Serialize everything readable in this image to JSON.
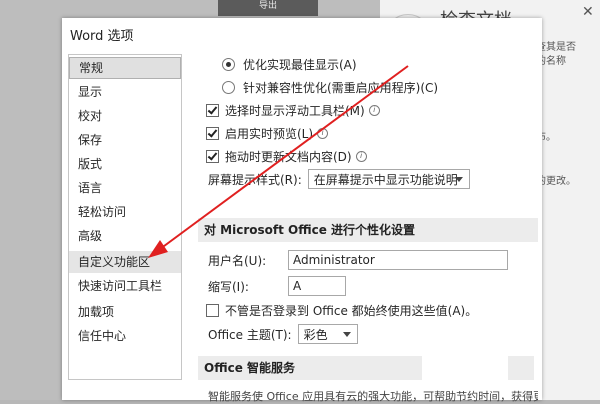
{
  "background": {
    "button_label": "导出",
    "heading": "检查文档",
    "side_texts": [
      "查其是否",
      "的名称",
      "布。",
      "的更改。"
    ],
    "close_glyph": "✕"
  },
  "dialog": {
    "title": "Word 选项",
    "nav_items": [
      {
        "label": "常规",
        "state": "active"
      },
      {
        "label": "显示",
        "state": "normal"
      },
      {
        "label": "校对",
        "state": "normal"
      },
      {
        "label": "保存",
        "state": "normal"
      },
      {
        "label": "版式",
        "state": "normal"
      },
      {
        "label": "语言",
        "state": "normal"
      },
      {
        "label": "轻松访问",
        "state": "normal"
      },
      {
        "label": "高级",
        "state": "normal"
      },
      {
        "label": "自定义功能区",
        "state": "hover"
      },
      {
        "label": "快速访问工具栏",
        "state": "normal"
      },
      {
        "label": "加载项",
        "state": "normal"
      },
      {
        "label": "信任中心",
        "state": "normal"
      }
    ]
  },
  "general": {
    "radio_optimize_appearance": "优化实现最佳显示(A)",
    "radio_optimize_compat": "针对兼容性优化(需重启应用程序)(C)",
    "chk_mini_toolbar": "选择时显示浮动工具栏(M)",
    "chk_live_preview": "启用实时预览(L)",
    "chk_update_drag": "拖动时更新文档内容(D)",
    "screentip_label": "屏幕提示样式(R):",
    "screentip_value": "在屏幕提示中显示功能说明",
    "section_personalize": "对 Microsoft Office 进行个性化设置",
    "username_label": "用户名(U):",
    "username_value": "Administrator",
    "initials_label": "缩写(I):",
    "initials_value": "A",
    "chk_always_use": "不管是否登录到 Office 都始终使用这些值(A)。",
    "theme_label": "Office 主题(T):",
    "theme_value": "彩色",
    "section_intelligent": "Office 智能服务",
    "intelligent_text": "智能服务使 Office 应用具有云的强大功能，可帮助节约时间，获得更"
  },
  "icons": {
    "info": "info-icon",
    "dropdown": "chevron-down-icon",
    "annotation": "red-arrow"
  },
  "colors": {
    "annotation_arrow": "#e02020",
    "section_bg": "#ececec",
    "nav_active_bg": "#e0e0e0"
  }
}
